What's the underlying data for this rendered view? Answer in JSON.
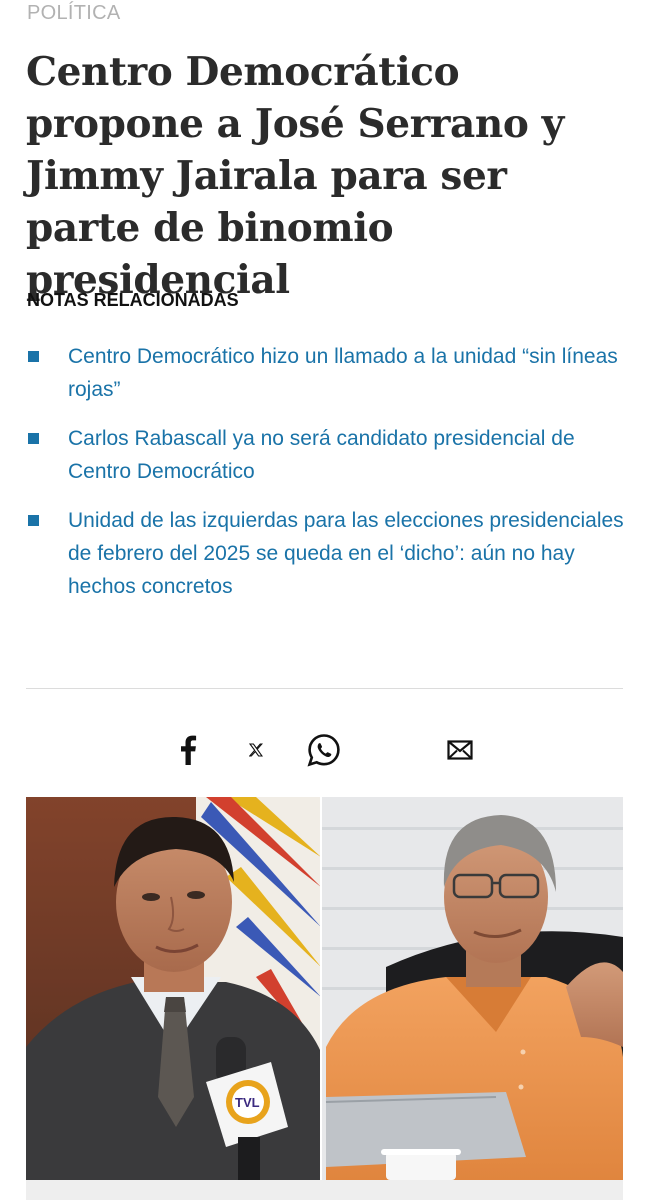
{
  "article": {
    "section": "POLÍTICA",
    "headline": "Centro Democrático propone a José Serrano y Jimmy Jairala para ser parte de binomio presidencial"
  },
  "related": {
    "title": "NOTAS RELACIONADAS",
    "items": [
      {
        "label": "Centro Democrático hizo un llamado a la unidad “sin líneas rojas”"
      },
      {
        "label": "Carlos Rabascall ya no será candidato presidencial de Centro Democrático"
      },
      {
        "label": "Unidad de las izquierdas para las elecciones presidenciales de febrero del 2025 se queda en el ‘dicho’: aún no hay hechos concretos"
      }
    ]
  },
  "share": {
    "buttons": [
      {
        "icon": "facebook-icon"
      },
      {
        "icon": "x-icon"
      },
      {
        "icon": "whatsapp-icon"
      },
      {
        "icon": "email-icon"
      }
    ]
  },
  "photo": {
    "microphone_logo": "TVL"
  },
  "colors": {
    "link": "#1a73a8",
    "headline": "#2b2b2b",
    "section": "#b2b2b2",
    "divider": "#dcdcdc"
  }
}
